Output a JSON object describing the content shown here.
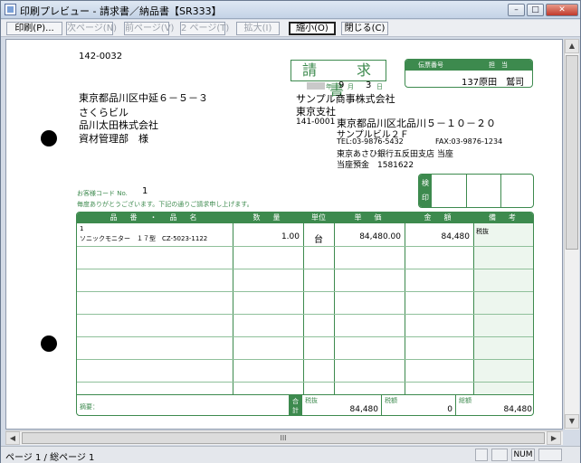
{
  "window": {
    "title": "印刷プレビュー - 請求書／納品書【SR333】",
    "buttons": {
      "minimize": "–",
      "maximize": "□",
      "close": "✕"
    }
  },
  "toolbar": {
    "print": "印刷(P)...",
    "next_page": "次ページ(N)",
    "prev_page": "前ページ(V)",
    "two_page": "2 ページ(T)",
    "zoom_in": "拡大(I)",
    "zoom_out": "縮小(O)",
    "close": "閉じる(C)"
  },
  "document": {
    "recipient": {
      "zip": "142-0032",
      "address": "東京都品川区中延６－５－３",
      "building": "さくらビル",
      "company": "品川太田株式会社",
      "department": "資材管理部　様"
    },
    "title": "請　求　書",
    "date": {
      "year_suffix": "年",
      "month": "9",
      "month_suffix": "月",
      "day": "3",
      "day_suffix": "日"
    },
    "stamp_box": {
      "col1": "伝票番号",
      "col2": "担　当",
      "value": "137原田　鷲司"
    },
    "sender": {
      "company": "サンプル商事株式会社",
      "branch": "東京支社",
      "zip": "141-0001",
      "address": "東京都品川区北品川５－１０－２０",
      "building": "サンプルビル２Ｆ",
      "tel": "TEL:03-9876-5432",
      "fax": "FAX:03-9876-1234",
      "bank": "東京あさひ銀行五反田支店 当座",
      "account": "当座預金　1581622"
    },
    "seal_label": "検印",
    "customer_no": "お客様コード No.",
    "customer_no_value": "1",
    "greeting": "毎度ありがとうございます。下記の通りご請求申し上げます。",
    "table": {
      "headers": [
        "品　番　・　品　名",
        "数　量",
        "単位",
        "単　価",
        "金　額",
        "備　考"
      ],
      "rows": [
        {
          "line": "1",
          "name": "ソニックモニター　１７型　CZ-5023-1122",
          "qty": "1.00",
          "unit": "台",
          "price": "84,480.00",
          "amount": "84,480",
          "note": "税抜"
        }
      ]
    },
    "footer": {
      "memo": "摘要：",
      "total_label": "合計",
      "subtotal_label": "税抜",
      "subtotal": "84,480",
      "tax_label": "税額",
      "tax": "0",
      "grand_label": "総額",
      "grand": "84,480"
    }
  },
  "scrollbar": {
    "up": "▲",
    "down": "▼",
    "left": "◀",
    "right": "▶",
    "grip": "III"
  },
  "status": {
    "page": "ページ 1 / 総ページ 1",
    "num": "NUM"
  }
}
